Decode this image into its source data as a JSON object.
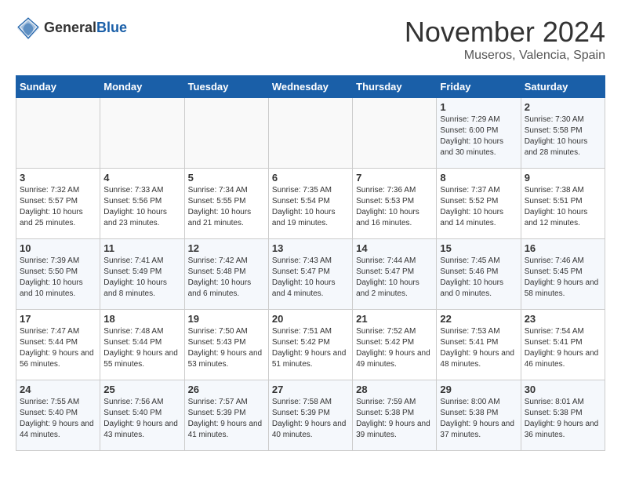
{
  "logo": {
    "general": "General",
    "blue": "Blue"
  },
  "title": "November 2024",
  "location": "Museros, Valencia, Spain",
  "days_header": [
    "Sunday",
    "Monday",
    "Tuesday",
    "Wednesday",
    "Thursday",
    "Friday",
    "Saturday"
  ],
  "weeks": [
    [
      {
        "day": "",
        "sunrise": "",
        "sunset": "",
        "daylight": ""
      },
      {
        "day": "",
        "sunrise": "",
        "sunset": "",
        "daylight": ""
      },
      {
        "day": "",
        "sunrise": "",
        "sunset": "",
        "daylight": ""
      },
      {
        "day": "",
        "sunrise": "",
        "sunset": "",
        "daylight": ""
      },
      {
        "day": "",
        "sunrise": "",
        "sunset": "",
        "daylight": ""
      },
      {
        "day": "1",
        "sunrise": "Sunrise: 7:29 AM",
        "sunset": "Sunset: 6:00 PM",
        "daylight": "Daylight: 10 hours and 30 minutes."
      },
      {
        "day": "2",
        "sunrise": "Sunrise: 7:30 AM",
        "sunset": "Sunset: 5:58 PM",
        "daylight": "Daylight: 10 hours and 28 minutes."
      }
    ],
    [
      {
        "day": "3",
        "sunrise": "Sunrise: 7:32 AM",
        "sunset": "Sunset: 5:57 PM",
        "daylight": "Daylight: 10 hours and 25 minutes."
      },
      {
        "day": "4",
        "sunrise": "Sunrise: 7:33 AM",
        "sunset": "Sunset: 5:56 PM",
        "daylight": "Daylight: 10 hours and 23 minutes."
      },
      {
        "day": "5",
        "sunrise": "Sunrise: 7:34 AM",
        "sunset": "Sunset: 5:55 PM",
        "daylight": "Daylight: 10 hours and 21 minutes."
      },
      {
        "day": "6",
        "sunrise": "Sunrise: 7:35 AM",
        "sunset": "Sunset: 5:54 PM",
        "daylight": "Daylight: 10 hours and 19 minutes."
      },
      {
        "day": "7",
        "sunrise": "Sunrise: 7:36 AM",
        "sunset": "Sunset: 5:53 PM",
        "daylight": "Daylight: 10 hours and 16 minutes."
      },
      {
        "day": "8",
        "sunrise": "Sunrise: 7:37 AM",
        "sunset": "Sunset: 5:52 PM",
        "daylight": "Daylight: 10 hours and 14 minutes."
      },
      {
        "day": "9",
        "sunrise": "Sunrise: 7:38 AM",
        "sunset": "Sunset: 5:51 PM",
        "daylight": "Daylight: 10 hours and 12 minutes."
      }
    ],
    [
      {
        "day": "10",
        "sunrise": "Sunrise: 7:39 AM",
        "sunset": "Sunset: 5:50 PM",
        "daylight": "Daylight: 10 hours and 10 minutes."
      },
      {
        "day": "11",
        "sunrise": "Sunrise: 7:41 AM",
        "sunset": "Sunset: 5:49 PM",
        "daylight": "Daylight: 10 hours and 8 minutes."
      },
      {
        "day": "12",
        "sunrise": "Sunrise: 7:42 AM",
        "sunset": "Sunset: 5:48 PM",
        "daylight": "Daylight: 10 hours and 6 minutes."
      },
      {
        "day": "13",
        "sunrise": "Sunrise: 7:43 AM",
        "sunset": "Sunset: 5:47 PM",
        "daylight": "Daylight: 10 hours and 4 minutes."
      },
      {
        "day": "14",
        "sunrise": "Sunrise: 7:44 AM",
        "sunset": "Sunset: 5:47 PM",
        "daylight": "Daylight: 10 hours and 2 minutes."
      },
      {
        "day": "15",
        "sunrise": "Sunrise: 7:45 AM",
        "sunset": "Sunset: 5:46 PM",
        "daylight": "Daylight: 10 hours and 0 minutes."
      },
      {
        "day": "16",
        "sunrise": "Sunrise: 7:46 AM",
        "sunset": "Sunset: 5:45 PM",
        "daylight": "Daylight: 9 hours and 58 minutes."
      }
    ],
    [
      {
        "day": "17",
        "sunrise": "Sunrise: 7:47 AM",
        "sunset": "Sunset: 5:44 PM",
        "daylight": "Daylight: 9 hours and 56 minutes."
      },
      {
        "day": "18",
        "sunrise": "Sunrise: 7:48 AM",
        "sunset": "Sunset: 5:44 PM",
        "daylight": "Daylight: 9 hours and 55 minutes."
      },
      {
        "day": "19",
        "sunrise": "Sunrise: 7:50 AM",
        "sunset": "Sunset: 5:43 PM",
        "daylight": "Daylight: 9 hours and 53 minutes."
      },
      {
        "day": "20",
        "sunrise": "Sunrise: 7:51 AM",
        "sunset": "Sunset: 5:42 PM",
        "daylight": "Daylight: 9 hours and 51 minutes."
      },
      {
        "day": "21",
        "sunrise": "Sunrise: 7:52 AM",
        "sunset": "Sunset: 5:42 PM",
        "daylight": "Daylight: 9 hours and 49 minutes."
      },
      {
        "day": "22",
        "sunrise": "Sunrise: 7:53 AM",
        "sunset": "Sunset: 5:41 PM",
        "daylight": "Daylight: 9 hours and 48 minutes."
      },
      {
        "day": "23",
        "sunrise": "Sunrise: 7:54 AM",
        "sunset": "Sunset: 5:41 PM",
        "daylight": "Daylight: 9 hours and 46 minutes."
      }
    ],
    [
      {
        "day": "24",
        "sunrise": "Sunrise: 7:55 AM",
        "sunset": "Sunset: 5:40 PM",
        "daylight": "Daylight: 9 hours and 44 minutes."
      },
      {
        "day": "25",
        "sunrise": "Sunrise: 7:56 AM",
        "sunset": "Sunset: 5:40 PM",
        "daylight": "Daylight: 9 hours and 43 minutes."
      },
      {
        "day": "26",
        "sunrise": "Sunrise: 7:57 AM",
        "sunset": "Sunset: 5:39 PM",
        "daylight": "Daylight: 9 hours and 41 minutes."
      },
      {
        "day": "27",
        "sunrise": "Sunrise: 7:58 AM",
        "sunset": "Sunset: 5:39 PM",
        "daylight": "Daylight: 9 hours and 40 minutes."
      },
      {
        "day": "28",
        "sunrise": "Sunrise: 7:59 AM",
        "sunset": "Sunset: 5:38 PM",
        "daylight": "Daylight: 9 hours and 39 minutes."
      },
      {
        "day": "29",
        "sunrise": "Sunrise: 8:00 AM",
        "sunset": "Sunset: 5:38 PM",
        "daylight": "Daylight: 9 hours and 37 minutes."
      },
      {
        "day": "30",
        "sunrise": "Sunrise: 8:01 AM",
        "sunset": "Sunset: 5:38 PM",
        "daylight": "Daylight: 9 hours and 36 minutes."
      }
    ]
  ]
}
